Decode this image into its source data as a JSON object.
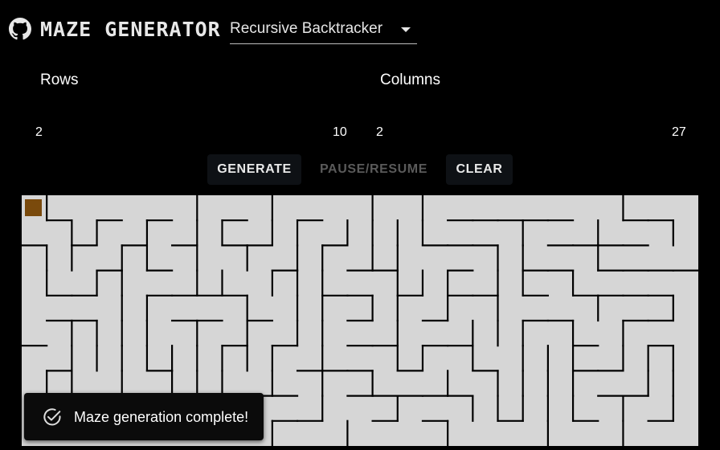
{
  "header": {
    "title": "MAZE GENERATOR",
    "github_icon": "github-icon",
    "algorithm": {
      "selected": "Recursive Backtracker",
      "caret_icon": "caret-down-icon"
    }
  },
  "controls": {
    "rows": {
      "label": "Rows",
      "min": "2",
      "max": "10"
    },
    "columns": {
      "label": "Columns",
      "min": "2",
      "max": "27"
    }
  },
  "buttons": {
    "generate": "GENERATE",
    "pause_resume": "PAUSE/RESUME",
    "clear": "CLEAR"
  },
  "maze": {
    "rows": 10,
    "columns": 27,
    "background_color": "#d6d6d6",
    "wall_color": "#000000",
    "current_cell_color": "#7a4a0c",
    "current_cell": {
      "row": 0,
      "col": 0
    }
  },
  "toast": {
    "icon": "check-circle-icon",
    "message": "Maze generation complete!"
  }
}
